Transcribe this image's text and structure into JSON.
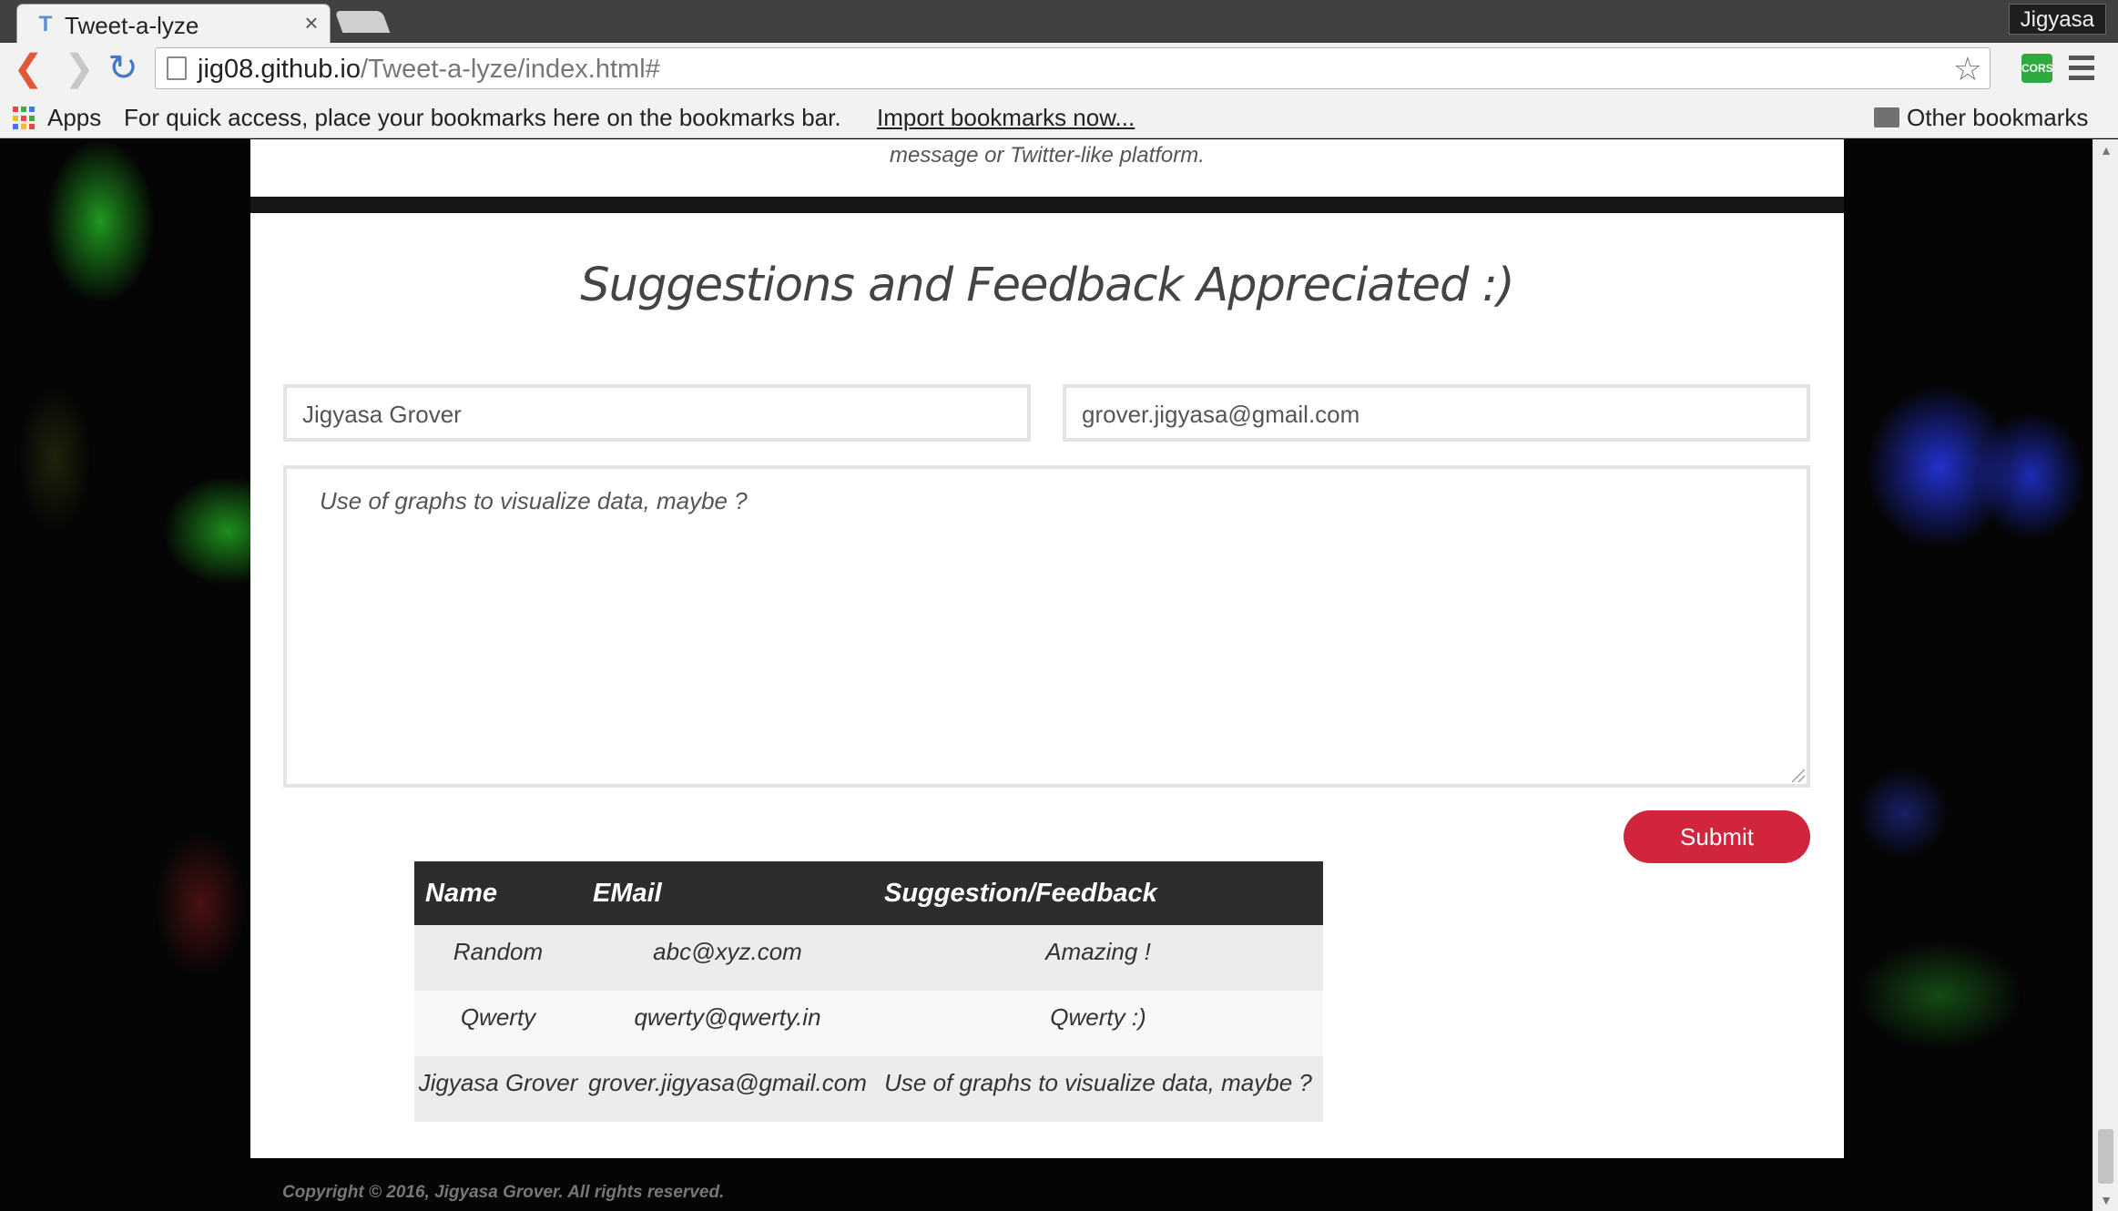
{
  "browser": {
    "tab_title": "Tweet-a-lyze",
    "tab_close": "×",
    "profile_name": "Jigyasa",
    "url_host": "jig08.github.io",
    "url_path": "/Tweet-a-lyze/index.html#",
    "extension_label": "CORS",
    "bookmarks": {
      "apps_label": "Apps",
      "hint": "For quick access, place your bookmarks here on the bookmarks bar.",
      "import_link": "Import bookmarks now...",
      "other_label": "Other bookmarks"
    }
  },
  "page": {
    "prev_section_text": "message or Twitter-like platform.",
    "feedback_title": "Suggestions and Feedback Appreciated :)",
    "form": {
      "name_value": "Jigyasa Grover",
      "email_value": "grover.jigyasa@gmail.com",
      "message_value": "Use of graphs to visualize data, maybe ?",
      "submit_label": "Submit"
    },
    "table": {
      "headers": [
        "Name",
        "EMail",
        "Suggestion/Feedback"
      ],
      "rows": [
        [
          "Random",
          "abc@xyz.com",
          "Amazing !"
        ],
        [
          "Qwerty",
          "qwerty@qwerty.in",
          "Qwerty :)"
        ],
        [
          "Jigyasa Grover",
          "grover.jigyasa@gmail.com",
          "Use of graphs to visualize data, maybe ?"
        ]
      ]
    },
    "copyright": "Copyright © 2016, Jigyasa Grover. All rights reserved."
  },
  "colors": {
    "accent_submit": "#d0253c",
    "table_header_bg": "#2d2d2d"
  }
}
